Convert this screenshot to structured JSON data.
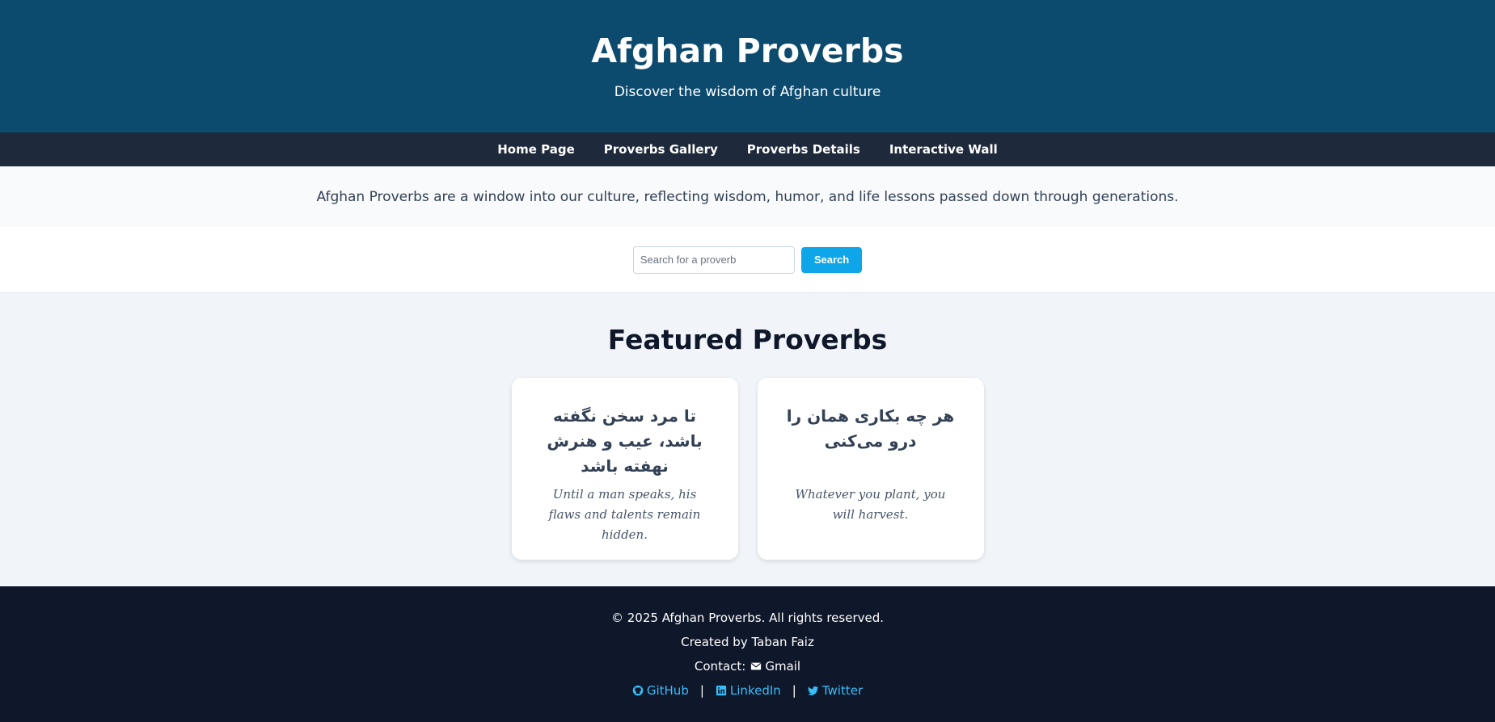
{
  "header": {
    "title": "Afghan Proverbs",
    "subtitle": "Discover the wisdom of Afghan culture"
  },
  "nav": {
    "items": [
      {
        "label": "Home Page"
      },
      {
        "label": "Proverbs Gallery"
      },
      {
        "label": "Proverbs Details"
      },
      {
        "label": "Interactive Wall"
      }
    ]
  },
  "intro": {
    "text": "Afghan Proverbs are a window into our culture, reflecting wisdom, humor, and life lessons passed down through generations."
  },
  "search": {
    "placeholder": "Search for a proverb",
    "value": "",
    "button_label": "Search"
  },
  "featured": {
    "heading": "Featured Proverbs",
    "cards": [
      {
        "persian": "تا مرد سخن نگفته باشد، عیب و هنرش نهفته باشد",
        "english": "Until a man speaks, his flaws and talents remain hidden."
      },
      {
        "persian": "هر چه بکاری همان را درو می‌کنی",
        "english": "Whatever you plant, you will harvest."
      }
    ]
  },
  "footer": {
    "copyright": "© 2025 Afghan Proverbs. All rights reserved.",
    "created_by": "Created by Taban Faiz",
    "contact_label": "Contact:",
    "contact_link": "Gmail",
    "contact_icon": "envelope-icon",
    "links": [
      {
        "label": "GitHub",
        "icon": "github-icon"
      },
      {
        "label": "LinkedIn",
        "icon": "linkedin-icon"
      },
      {
        "label": "Twitter",
        "icon": "twitter-icon"
      }
    ],
    "separator": "|"
  },
  "colors": {
    "header_bg": "#0c4a6e",
    "nav_bg": "#1e293b",
    "accent": "#0ea5e9",
    "link": "#38bdf8",
    "footer_bg": "#0f172a"
  }
}
